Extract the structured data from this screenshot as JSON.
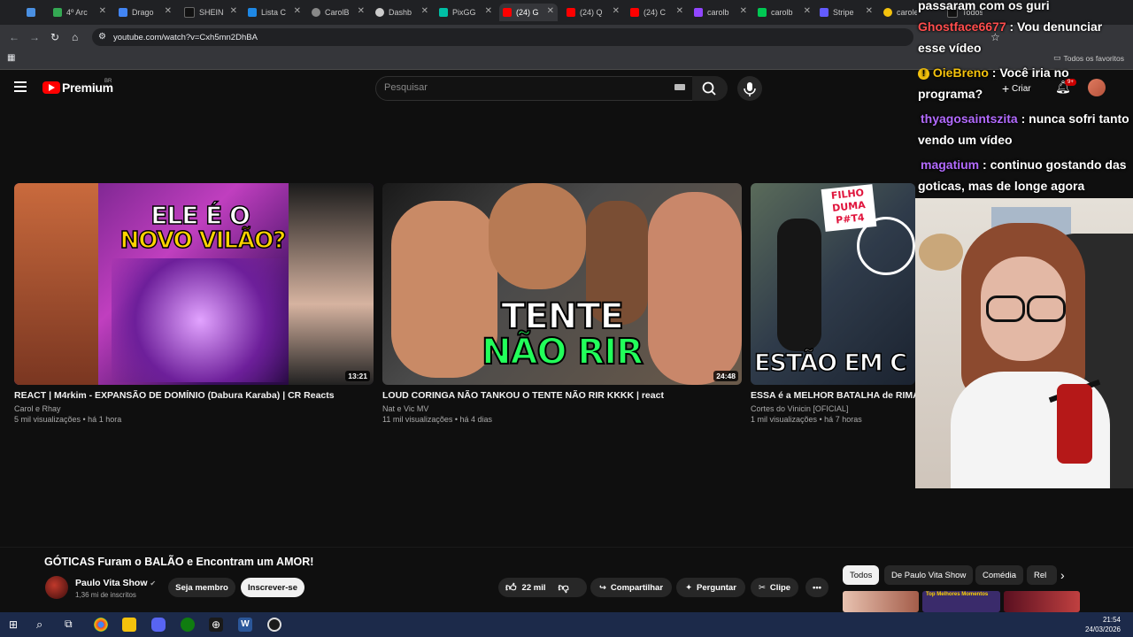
{
  "browser": {
    "tabs": [
      {
        "label": "",
        "color": "#4a90e2"
      },
      {
        "label": "4º Arc",
        "color": "#34a853"
      },
      {
        "label": "Drago",
        "color": "#4285f4"
      },
      {
        "label": "SHEIN",
        "color": "#111111"
      },
      {
        "label": "Lista C",
        "color": "#1e88e5"
      },
      {
        "label": "CarolB",
        "color": "#888888"
      },
      {
        "label": "Dashb",
        "color": "#cccccc"
      },
      {
        "label": "PixGG",
        "color": "#00bfa5"
      },
      {
        "label": "(24) G",
        "color": "#ff0000"
      },
      {
        "label": "(24) Q",
        "color": "#ff0000"
      },
      {
        "label": "(24) C",
        "color": "#ff0000"
      },
      {
        "label": "carolb",
        "color": "#9146ff"
      },
      {
        "label": "carolb",
        "color": "#00c853"
      },
      {
        "label": "Stripe",
        "color": "#635bff"
      },
      {
        "label": "carole",
        "color": "#f4c20d"
      },
      {
        "label": "Todos",
        "color": "#111111"
      }
    ],
    "url": "youtube.com/watch?v=Cxh5mn2DhBA",
    "bookmarks_label": "Todos os favoritos"
  },
  "youtube_header": {
    "logo_text": "Premium",
    "region": "BR",
    "search_placeholder": "Pesquisar",
    "create_label": "Criar",
    "notification_count": "9+"
  },
  "videos": [
    {
      "thumb_text_top": "ELE É O",
      "thumb_text_bottom": "NOVO VILÃO?",
      "duration": "13:21",
      "title": "REACT | M4rkim - EXPANSÃO DE DOMÍNIO (Dabura Karaba) | CR Reacts",
      "channel": "Carol e Rhay",
      "meta": "5 mil visualizações • há 1 hora"
    },
    {
      "thumb_text_top": "TENTE",
      "thumb_text_bottom": "NÃO RIR",
      "duration": "24:48",
      "title": "LOUD CORINGA NÃO TANKOU O TENTE NÃO RIR KKKK | react",
      "channel": "Nat e Vic MV",
      "meta": "11 mil visualizações • há 4 dias"
    },
    {
      "thumb_text_top": "FILHO DUMA P#T4",
      "thumb_text_bottom": "ESTÃO EM C",
      "duration": "",
      "title": "ESSA é a MELHOR BATALHA de RIMA",
      "channel": "Cortes do Vinicin [OFICIAL]",
      "meta": "1 mil visualizações • há 7 horas"
    }
  ],
  "current_video": {
    "title": "GÓTICAS Furam o BALÃO e Encontram um AMOR!",
    "channel_name": "Paulo Vita Show",
    "subscribers": "1,36 mi de inscritos",
    "member_label": "Seja membro",
    "subscribe_label": "Inscrever-se",
    "likes": "22 mil",
    "share_label": "Compartilhar",
    "ask_label": "Perguntar",
    "clip_label": "Clipe"
  },
  "chips": [
    "Todos",
    "De Paulo Vita Show",
    "Comédia",
    "Rel"
  ],
  "mini_thumb_text": "Top Melhores Momentos",
  "chat": [
    {
      "user": "",
      "text": "passaram com os guri",
      "color": "#ffffff"
    },
    {
      "user": "Ghostface6677",
      "text": ": Vou denunciar esse vídeo",
      "color": "#ff4d4d"
    },
    {
      "user": "OieBreno",
      "text": ": Você iria no programa?",
      "color": "#f4c20d"
    },
    {
      "user": "thyagosaintszita",
      "text": ": nunca sofri tanto vendo um vídeo",
      "color": "#b36bff"
    },
    {
      "user": "magatium",
      "text": ": continuo gostando das goticas, mas de longe agora",
      "color": "#b36bff"
    }
  ],
  "clock": {
    "time": "21:54",
    "date": "24/03/2026"
  }
}
